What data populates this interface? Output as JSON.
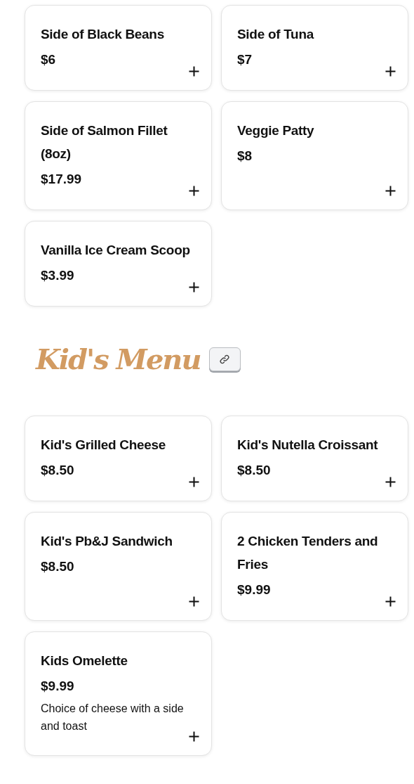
{
  "sections": [
    {
      "items": [
        {
          "name": "Side of Black Beans",
          "price": "$6"
        },
        {
          "name": "Side of Tuna",
          "price": "$7"
        },
        {
          "name": "Side of Salmon Fillet (8oz)",
          "price": "$17.99"
        },
        {
          "name": "Veggie Patty",
          "price": "$8"
        },
        {
          "name": "Vanilla Ice Cream Scoop",
          "price": "$3.99"
        }
      ]
    },
    {
      "title": "Kid's Menu",
      "items": [
        {
          "name": "Kid's Grilled Cheese",
          "price": "$8.50"
        },
        {
          "name": "Kid's Nutella Croissant",
          "price": "$8.50"
        },
        {
          "name": "Kid's Pb&J Sandwich",
          "price": "$8.50"
        },
        {
          "name": "2 Chicken Tenders and Fries",
          "price": "$9.99"
        },
        {
          "name": "Kids Omelette",
          "price": "$9.99",
          "description": "Choice of cheese with a side and toast"
        }
      ]
    }
  ]
}
